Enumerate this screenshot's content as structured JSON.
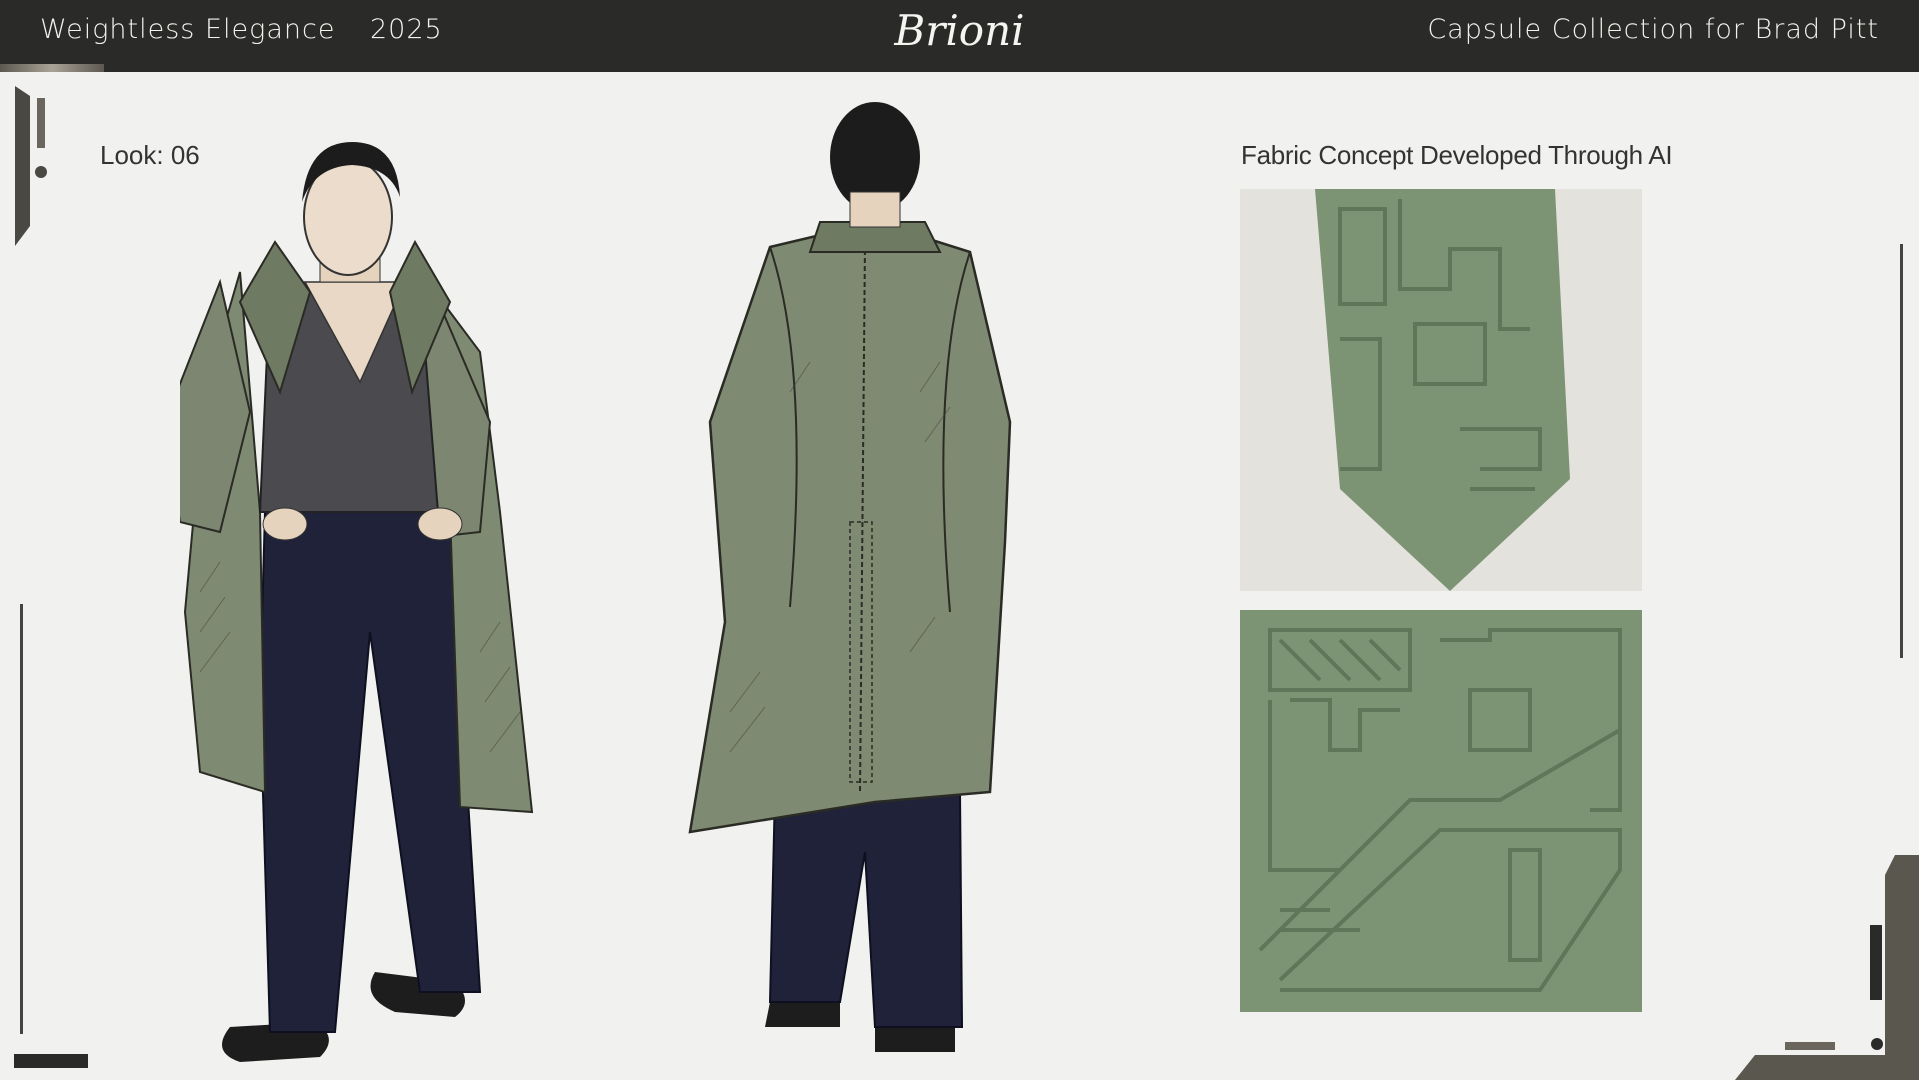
{
  "header": {
    "title": "Weightless Elegance",
    "year": "2025",
    "brand": "Brioni",
    "collection": "Capsule Collection for  Brad Pitt"
  },
  "look": {
    "label": "Look: 06"
  },
  "fabric": {
    "title": "Fabric Concept Developed Through AI"
  },
  "colors": {
    "topbar": "#2a2a28",
    "background": "#f1f1ef",
    "coat_green": "#7f8a72",
    "fabric_green": "#7c9474",
    "trousers_navy": "#1f2238",
    "shirt_charcoal": "#4a4a4f"
  }
}
